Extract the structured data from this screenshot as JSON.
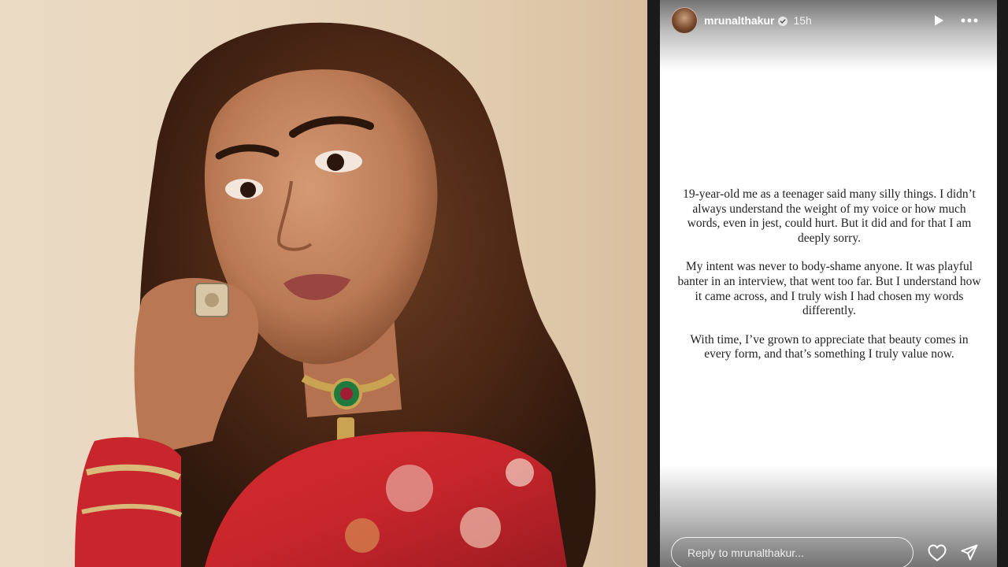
{
  "story": {
    "username": "mrunalthakur",
    "time_ago": "15h",
    "verified": true,
    "paragraphs": [
      "19-year-old me as a teenager said many silly things. I didn’t always understand the weight of my voice or how much words, even in jest, could hurt. But it did and for that I am deeply sorry.",
      "My intent was never to body-shame anyone. It was playful banter in an interview, that went too far. But I understand how it came across, and I truly wish I had chosen my words differently.",
      "With time, I’ve grown to appreciate that beauty comes in every form, and that’s something I truly value now."
    ],
    "reply_placeholder": "Reply to mrunalthakur..."
  },
  "icons": {
    "verified": "verified-badge-icon",
    "play": "play-icon",
    "more": "more-horizontal-icon",
    "like": "heart-icon",
    "share": "send-icon"
  },
  "colors": {
    "accent": "#ffffff",
    "text": "#222222",
    "photo_background": "#eadac4",
    "outfit_red": "#c8262c"
  }
}
